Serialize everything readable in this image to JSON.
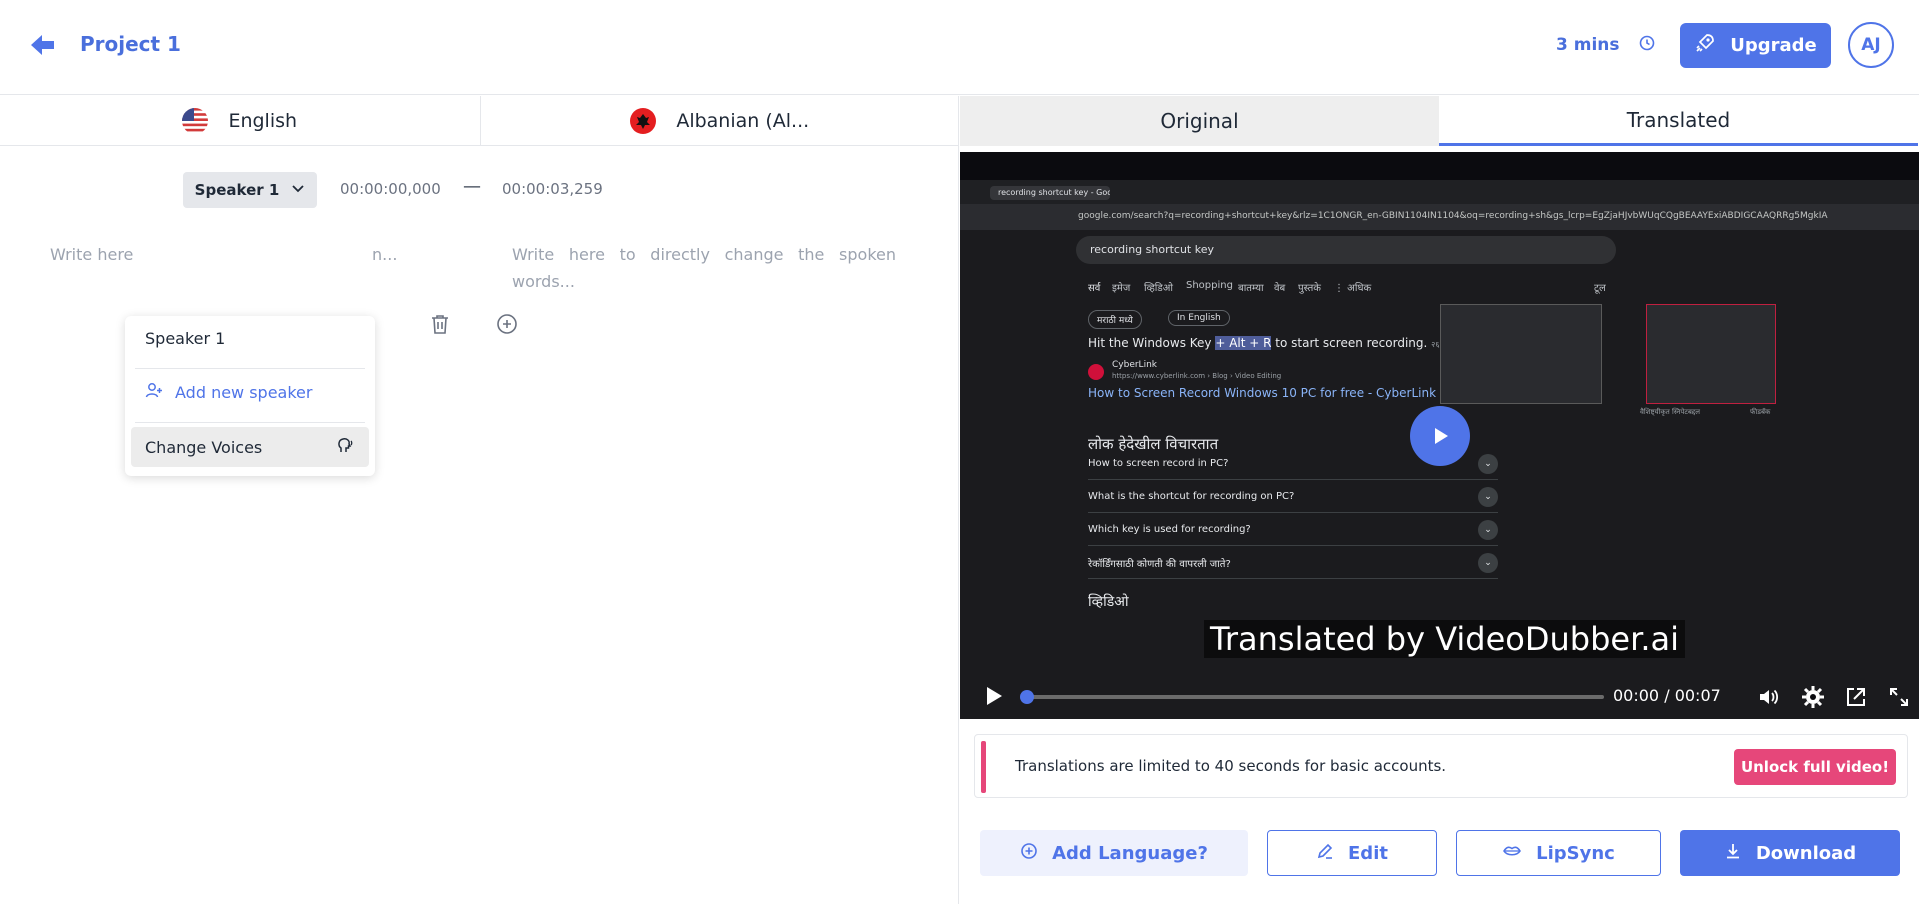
{
  "header": {
    "project_title": "Project 1",
    "minutes": "3 mins",
    "upgrade_label": "Upgrade",
    "avatar_initials": "AJ"
  },
  "languages": {
    "source": "English",
    "target": "Albanian (Al..."
  },
  "segment": {
    "speaker_label": "Speaker 1",
    "start_time": "00:00:00,000",
    "dash": "—",
    "end_time": "00:00:03,259",
    "source_placeholder_left": "Write here",
    "source_placeholder_right": "n...",
    "target_placeholder": "Write here to directly change the spoken words..."
  },
  "speaker_dropdown": {
    "items": [
      "Speaker 1",
      "Add new speaker",
      "Change Voices"
    ]
  },
  "view_tabs": {
    "original": "Original",
    "translated": "Translated"
  },
  "video": {
    "tab_title": "recording shortcut key - Google",
    "url": "google.com/search?q=recording+shortcut+key&rlz=1C1ONGR_en-GBIN1104IN1104&oq=recording+sh&gs_lcrp=EgZjaHJvbWUqCQgBEAAYExiABDIGCAAQRRg5MgkIARA...",
    "search_query": "recording shortcut key",
    "search_tabs": [
      "सर्व",
      "इमेज",
      "व्हिडिओ",
      "Shopping",
      "बातम्या",
      "वेब",
      "पुस्तके",
      "⋮ अधिक"
    ],
    "tools_label": "टूल",
    "lang_chips": [
      "मराठी मध्ये",
      "In English"
    ],
    "snippet_before": "Hit the Windows Key ",
    "snippet_highlight": "+ Alt + R",
    "snippet_after": " to start screen recording.",
    "snippet_date": "२६ जुलै, २०२४",
    "source_name": "CyberLink",
    "source_url": "https://www.cyberlink.com › Blog › Video Editing",
    "result_link": "How to Screen Record Windows 10 PC for free - CyberLink",
    "feedback_a": "वैशिष्ट्यीकृत स्निपेटबद्दल",
    "feedback_b": "फीडबॅक",
    "people_also_ask": "लोक हेदेखील विचारतात",
    "questions": [
      "How to screen record in PC?",
      "What is the shortcut for recording on PC?",
      "Which key is used for recording?",
      "रेकॉर्डिंगसाठी कोणती की वापरली जाते?"
    ],
    "videos_heading": "व्हिडिओ",
    "watermark": "Translated by VideoDubber.ai",
    "current_time": "00:00",
    "separator": "/",
    "duration": "00:07",
    "progress": 0.0
  },
  "limit_notice": {
    "text": "Translations are limited to 40 seconds for basic accounts.",
    "button": "Unlock full video!",
    "accent": "#e6477a"
  },
  "actions": {
    "add_language": "Add Language?",
    "edit": "Edit",
    "lipsync": "LipSync",
    "download": "Download"
  },
  "colors": {
    "primary": "#4f74e8",
    "accent": "#e6477a"
  }
}
